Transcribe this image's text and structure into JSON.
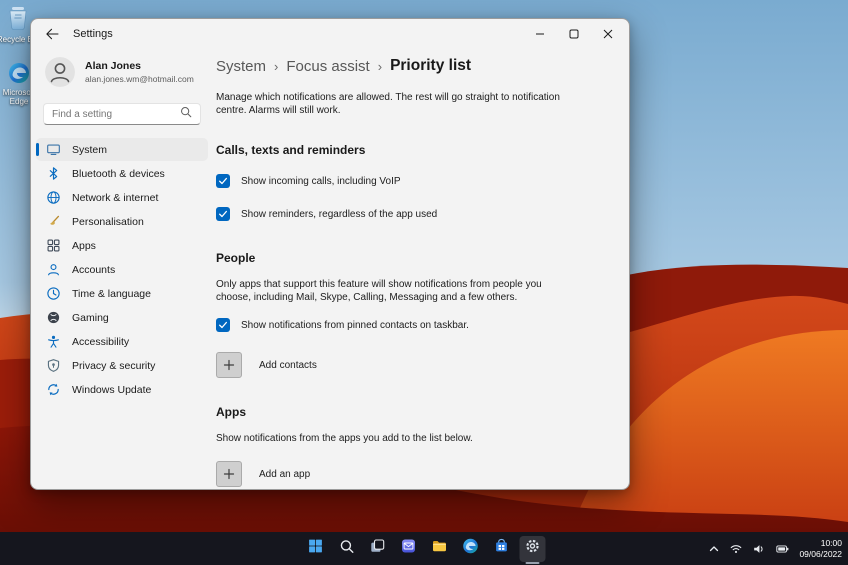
{
  "desktop": {
    "icons": [
      {
        "label": "Recycle Bin"
      },
      {
        "label": "Microsoft Edge"
      }
    ]
  },
  "window": {
    "title": "Settings",
    "sidebar": {
      "user_name": "Alan Jones",
      "user_email": "alan.jones.wm@hotmail.com",
      "search_placeholder": "Find a setting",
      "items": [
        {
          "label": "System",
          "selected": true
        },
        {
          "label": "Bluetooth & devices"
        },
        {
          "label": "Network & internet"
        },
        {
          "label": "Personalisation"
        },
        {
          "label": "Apps"
        },
        {
          "label": "Accounts"
        },
        {
          "label": "Time & language"
        },
        {
          "label": "Gaming"
        },
        {
          "label": "Accessibility"
        },
        {
          "label": "Privacy & security"
        },
        {
          "label": "Windows Update"
        }
      ]
    },
    "content": {
      "breadcrumb": {
        "level1": "System",
        "level2": "Focus assist",
        "current": "Priority list",
        "separator": "›"
      },
      "intro": "Manage which notifications are allowed. The rest will go straight to notification centre. Alarms will still work.",
      "calls": {
        "heading": "Calls, texts and reminders",
        "checkbox1": "Show incoming calls, including VoIP",
        "checkbox1_checked": true,
        "checkbox2": "Show reminders, regardless of the app used",
        "checkbox2_checked": true
      },
      "people": {
        "heading": "People",
        "description": "Only apps that support this feature will show notifications from people you choose, including Mail, Skype, Calling, Messaging and a few others.",
        "checkbox": "Show notifications from pinned contacts on taskbar.",
        "checkbox_checked": true,
        "add_label": "Add contacts"
      },
      "apps": {
        "heading": "Apps",
        "description": "Show notifications from the apps you add to the list below.",
        "add_label": "Add an app"
      }
    }
  },
  "taskbar": {
    "icons": [
      "start",
      "search",
      "task-view",
      "mail",
      "file-explorer",
      "edge",
      "microsoft-store",
      "settings"
    ],
    "tray_icons": [
      "hidden-icons-chevron",
      "wifi",
      "volume",
      "battery"
    ],
    "clock_time": "10:00",
    "clock_date": "09/06/2022"
  },
  "colors": {
    "accent": "#0067c0",
    "taskbar": "#15161e",
    "window_bg": "#f3f3f3"
  }
}
